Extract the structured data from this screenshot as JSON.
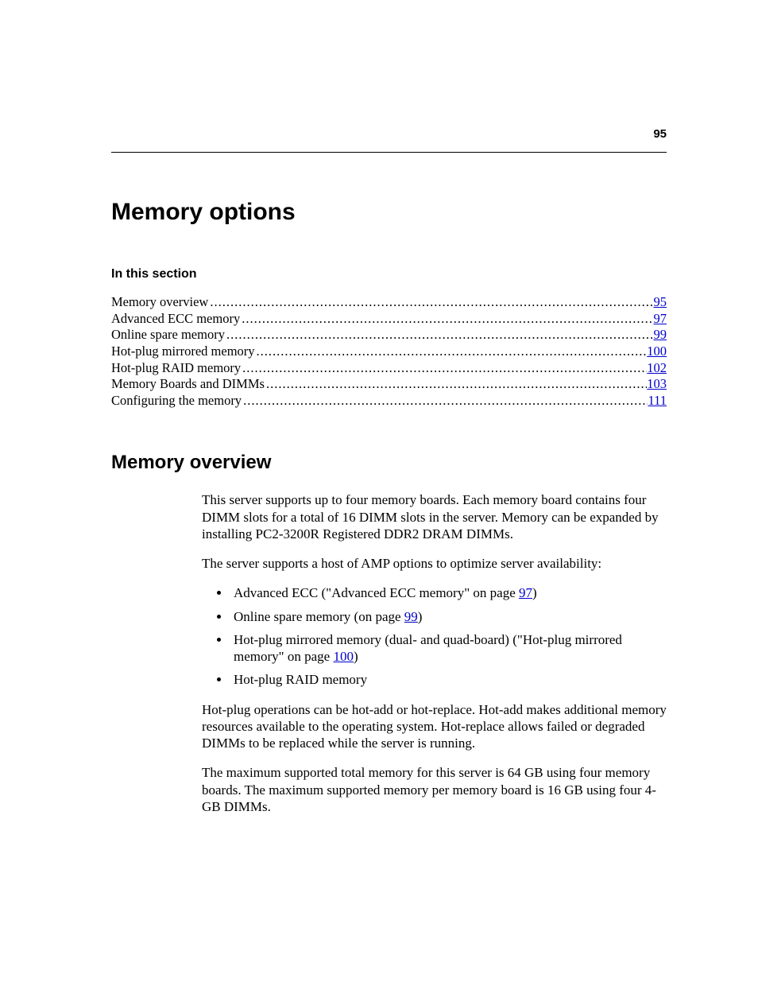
{
  "page_number": "95",
  "title": "Memory options",
  "section_heading": "In this section",
  "toc": [
    {
      "label": "Memory overview",
      "page": "95"
    },
    {
      "label": "Advanced ECC memory",
      "page": "97"
    },
    {
      "label": "Online spare memory",
      "page": "99"
    },
    {
      "label": "Hot-plug mirrored memory ",
      "page": "100"
    },
    {
      "label": "Hot-plug RAID memory",
      "page": "102"
    },
    {
      "label": "Memory Boards and DIMMs ",
      "page": "103"
    },
    {
      "label": "Configuring the memory ",
      "page": "111"
    }
  ],
  "subheading": "Memory overview",
  "para1": "This server supports up to four memory boards. Each memory board contains four DIMM slots for a total of 16 DIMM slots in the server. Memory can be expanded by installing PC2-3200R Registered DDR2 DRAM DIMMs.",
  "para2": "The server supports a host of AMP options to optimize server availability:",
  "bullets": {
    "b1_pre": "Advanced ECC (\"Advanced ECC memory\" on page ",
    "b1_link": "97",
    "b1_post": ")",
    "b2_pre": "Online spare memory (on page ",
    "b2_link": "99",
    "b2_post": ")",
    "b3_pre": "Hot-plug mirrored memory (dual- and quad-board) (\"Hot-plug mirrored memory\" on page ",
    "b3_link": "100",
    "b3_post": ")",
    "b4": "Hot-plug RAID memory"
  },
  "para3": "Hot-plug operations can be hot-add or hot-replace. Hot-add makes additional memory resources available to the operating system. Hot-replace allows failed or degraded DIMMs to be replaced while the server is running.",
  "para4": "The maximum supported total memory for this server is 64 GB using four memory boards. The maximum supported memory per memory board is 16 GB using four 4-GB DIMMs."
}
